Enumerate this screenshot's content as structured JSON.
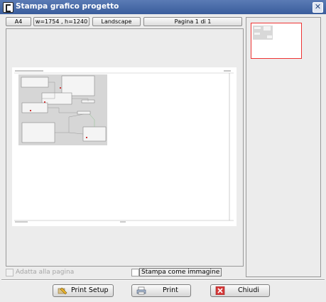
{
  "window": {
    "title": "Stampa grafico progetto",
    "close_label": "✕"
  },
  "toolbar": {
    "paper": "A4",
    "dimensions": "w=1754 , h=1240",
    "orientation": "Landscape",
    "page_indicator": "Pagina 1 di 1"
  },
  "options": {
    "fit_page_label": "Adatta alla pagina",
    "fit_page_enabled": false,
    "print_as_image_label": "Stampa come immagine",
    "print_as_image_checked": false
  },
  "buttons": {
    "print_setup": "Print Setup",
    "print": "Print",
    "close": "Chiudi"
  },
  "colors": {
    "titlebar": "#3a5d9c",
    "thumb_border": "#e33333",
    "close_icon": "#d63a3a"
  }
}
